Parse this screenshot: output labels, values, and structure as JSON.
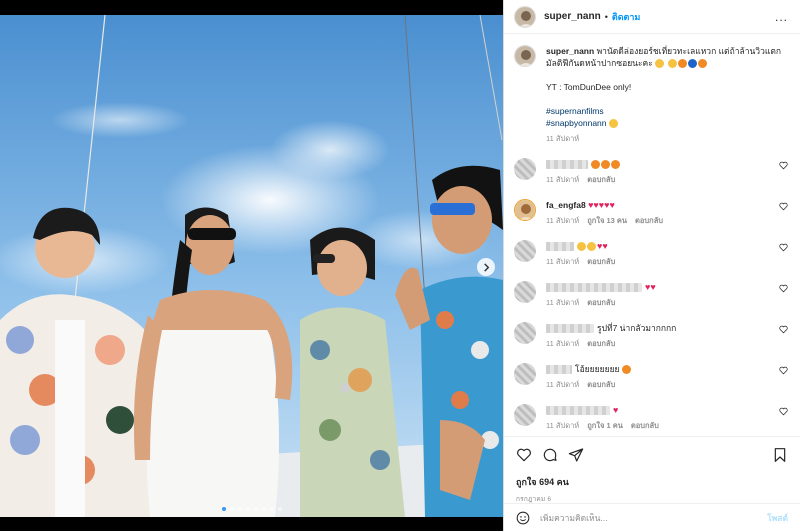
{
  "header": {
    "username": "super_nann",
    "dot": "•",
    "follow_label": "ติดตาม",
    "more": "..."
  },
  "caption": {
    "username": "super_nann",
    "text_line1": "พานัดดีล่องยอร์ชเที่ยวทะเลแหวก แต่ถ้าล้านวิวแตก",
    "text_line2": "มัลติฟีกันดหน้าปากซอยนะคะ",
    "yt_line": "YT : TomDunDee only!",
    "hashtag1": "#supernanfilms",
    "hashtag2": "#snapbyonnann",
    "time": "11 สัปดาห์"
  },
  "comments": [
    {
      "time": "11 สัปดาห์",
      "reply": "ตอบกลับ"
    },
    {
      "username": "fa_engfa8",
      "time": "11 สัปดาห์",
      "likes": "ถูกใจ 13 คน",
      "reply": "ตอบกลับ"
    },
    {
      "time": "11 สัปดาห์",
      "reply": "ตอบกลับ"
    },
    {
      "time": "11 สัปดาห์",
      "reply": "ตอบกลับ"
    },
    {
      "text": "รูปที่7 น่ากลัวมากกกก",
      "time": "11 สัปดาห์",
      "reply": "ตอบกลับ"
    },
    {
      "text": "โอ้ยยยยยยย",
      "time": "11 สัปดาห์",
      "reply": "ตอบกลับ"
    },
    {
      "time": "11 สัปดาห์",
      "likes": "ถูกใจ 1 คน",
      "reply": "ตอบกลับ"
    }
  ],
  "actions": {
    "likes_text": "ถูกใจ 694 คน",
    "date": "กรกฎาคม 6"
  },
  "add_comment": {
    "placeholder": "เพิ่มความคิดเห็น...",
    "post_label": "โพสต์"
  },
  "colors": {
    "follow_blue": "#0095f6",
    "heart_red": "#e0245e",
    "hashtag": "#00376b",
    "post_disabled": "#b2dffc"
  },
  "icons": [
    "chevron-right-icon",
    "more-icon",
    "heart-icon",
    "comment-icon",
    "share-icon",
    "bookmark-icon",
    "emoji-icon"
  ]
}
